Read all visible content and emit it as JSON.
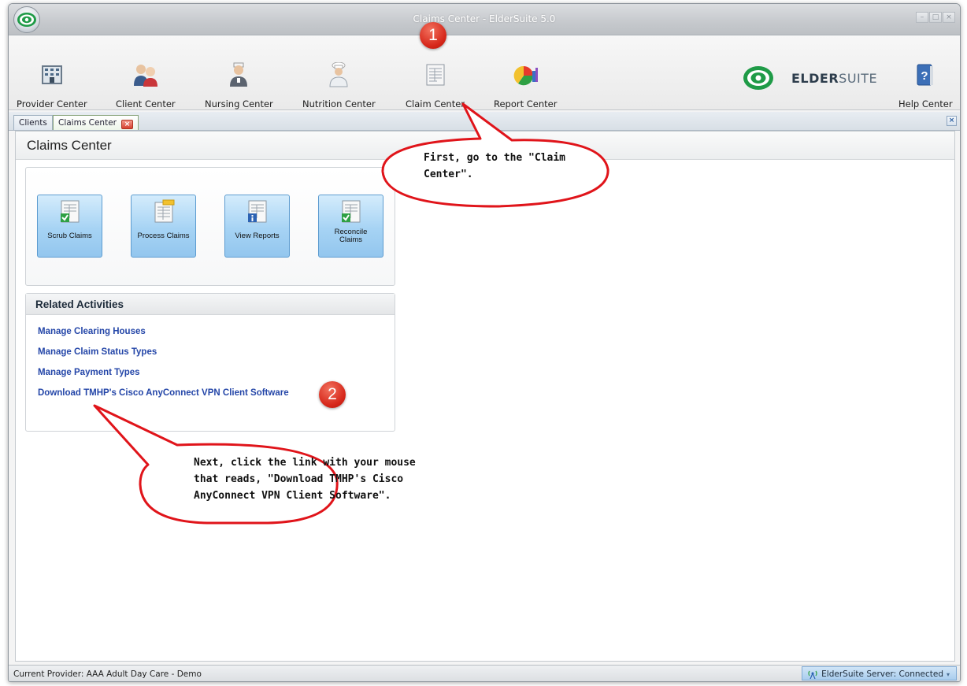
{
  "window": {
    "title": "Claims Center - ElderSuite 5.0"
  },
  "toolbar": {
    "items": [
      {
        "label": "Provider Center",
        "icon": "building-icon"
      },
      {
        "label": "Client Center",
        "icon": "people-icon"
      },
      {
        "label": "Nursing Center",
        "icon": "nurse-icon"
      },
      {
        "label": "Nutrition Center",
        "icon": "chef-icon"
      },
      {
        "label": "Claim Center",
        "icon": "claim-form-icon"
      },
      {
        "label": "Report Center",
        "icon": "pie-chart-icon"
      }
    ],
    "brand": {
      "eldr": "ELDER",
      "suite": "SUITE"
    },
    "help_label": "Help Center"
  },
  "tabs": [
    {
      "label": "Clients"
    },
    {
      "label": "Claims Center",
      "closable": true
    }
  ],
  "page": {
    "title": "Claims Center"
  },
  "actions": [
    {
      "label": "Scrub Claims"
    },
    {
      "label": "Process Claims"
    },
    {
      "label": "View Reports"
    },
    {
      "label": "Reconcile Claims"
    }
  ],
  "related": {
    "title": "Related Activities",
    "links": [
      "Manage Clearing Houses",
      "Manage Claim Status Types",
      "Manage Payment Types",
      "Download TMHP's Cisco AnyConnect VPN Client Software"
    ]
  },
  "status": {
    "left": "Current Provider: AAA Adult Day Care - Demo",
    "right": "ElderSuite Server: Connected"
  },
  "annotations": {
    "badge1": "1",
    "badge2": "2",
    "callout1": [
      "First, go to the \"Claim",
      "Center\"."
    ],
    "callout2": [
      "Next, click the link with your mouse",
      "that reads, \"Download TMHP's Cisco",
      "AnyConnect VPN Client Software\"."
    ]
  },
  "colors": {
    "accent_blue": "#2446a8",
    "callout_border": "#e0141a",
    "button_blue": "#a6d3f4"
  }
}
